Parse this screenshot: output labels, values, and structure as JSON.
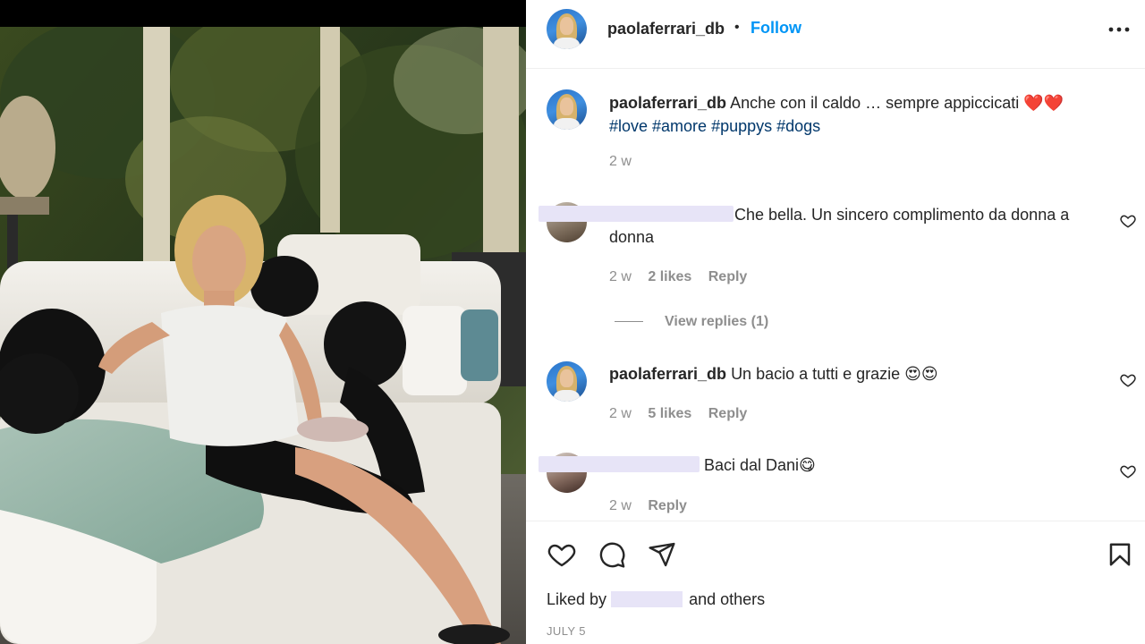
{
  "post": {
    "author": "paolaferrari_db",
    "follow_label": "Follow",
    "dot": "•",
    "more_label": "•••",
    "caption": "Anche con il caldo … sempre appiccicati ❤️❤️",
    "hashtags": "#love #amore #puppys #dogs",
    "caption_time": "2 w"
  },
  "comments": [
    {
      "username": "",
      "text": "Che bella. Un sincero complimento da donna a donna",
      "time": "2 w",
      "likes": "2 likes",
      "reply_label": "Reply",
      "view_replies": "View replies (1)"
    },
    {
      "username": "paolaferrari_db",
      "text": "Un bacio a tutti e grazie 😍😍",
      "time": "2 w",
      "likes": "5 likes",
      "reply_label": "Reply"
    },
    {
      "username": "",
      "text": "Baci dal Dani😋",
      "time": "2 w",
      "reply_label": "Reply"
    }
  ],
  "footer": {
    "liked_by_prefix": "Liked by",
    "liked_by_suffix": "and others",
    "date": "JULY 5"
  },
  "icons": {
    "like": "heart-outline",
    "comment": "speech-bubble",
    "share": "paper-plane",
    "save": "bookmark",
    "more": "ellipsis"
  },
  "colors": {
    "link": "#0095f6",
    "hashtag": "#00376b",
    "muted": "#8e8e8e",
    "redaction": "#e7e4f7"
  }
}
